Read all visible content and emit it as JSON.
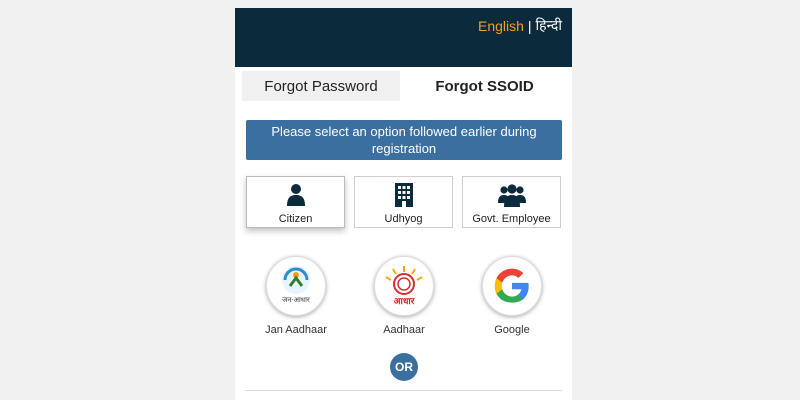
{
  "lang": {
    "english": "English",
    "separator": "|",
    "hindi": "हिन्दी"
  },
  "tabs": [
    {
      "label": "Forgot Password",
      "active": false
    },
    {
      "label": "Forgot SSOID",
      "active": true
    }
  ],
  "notice": "Please select an option followed earlier during registration",
  "categories": [
    {
      "label": "Citizen",
      "icon": "person-icon",
      "selected": true
    },
    {
      "label": "Udhyog",
      "icon": "building-icon",
      "selected": false
    },
    {
      "label": "Govt. Employee",
      "icon": "group-icon",
      "selected": false
    }
  ],
  "logins": [
    {
      "label": "Jan Aadhaar",
      "icon": "jan-aadhaar-logo",
      "logo_text": "जन-आधार"
    },
    {
      "label": "Aadhaar",
      "icon": "aadhaar-logo",
      "logo_text": "आधार"
    },
    {
      "label": "Google",
      "icon": "google-logo"
    }
  ],
  "or_label": "OR",
  "colors": {
    "header": "#0b2a3c",
    "accent": "#3b6fa0",
    "english_link": "#f0a020"
  }
}
